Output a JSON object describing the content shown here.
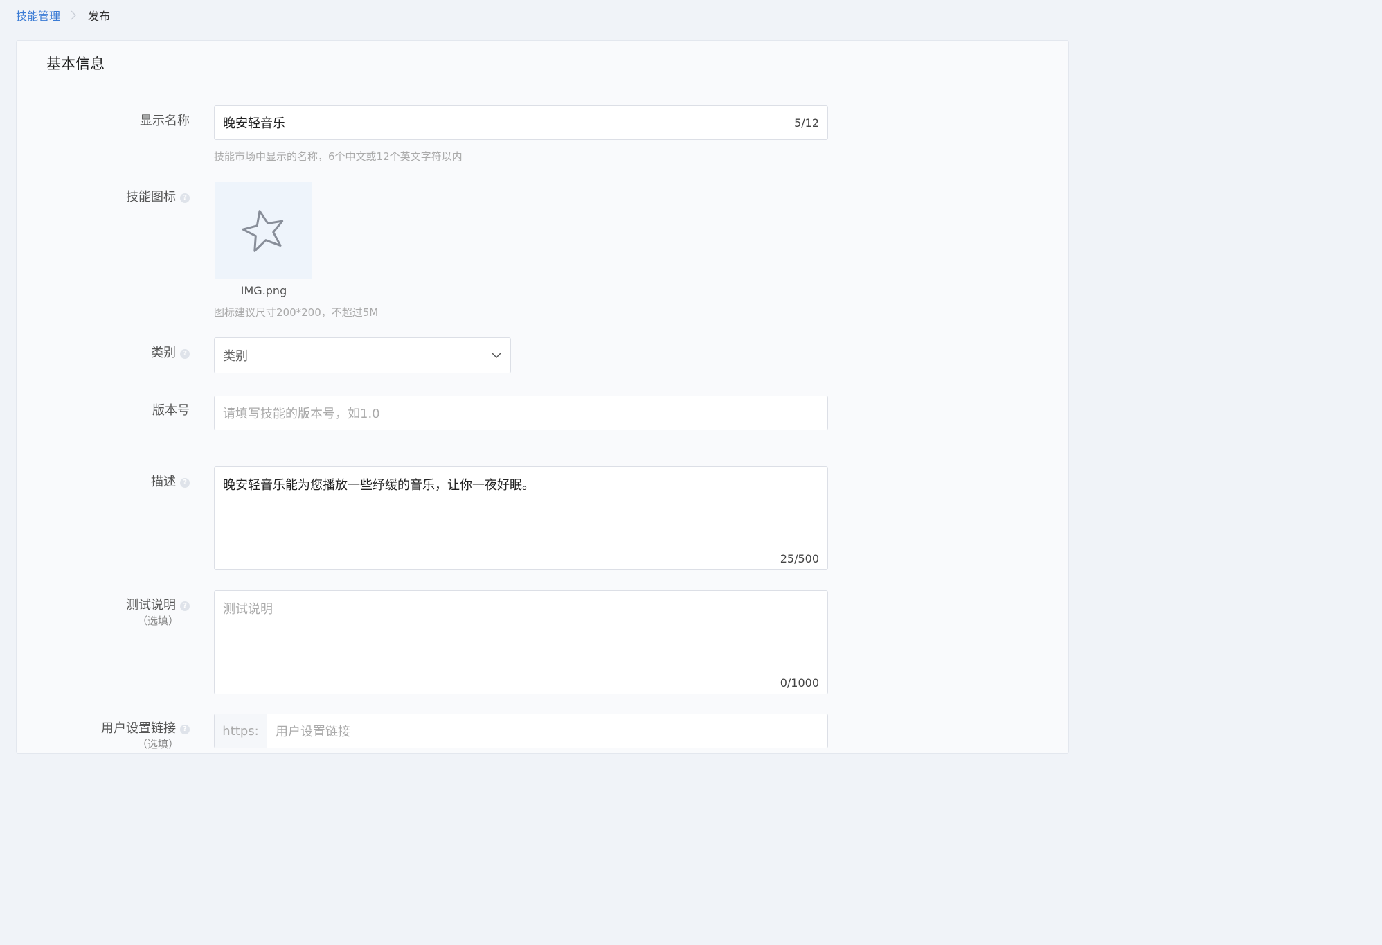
{
  "breadcrumb": {
    "parent": "技能管理",
    "current": "发布"
  },
  "section": {
    "title": "基本信息"
  },
  "form": {
    "display_name": {
      "label": "显示名称",
      "value": "晚安轻音乐",
      "counter": "5/12",
      "hint": "技能市场中显示的名称，6个中文或12个英文字符以内"
    },
    "skill_icon": {
      "label": "技能图标",
      "file_name": "IMG.png",
      "hint": "图标建议尺寸200*200，不超过5M"
    },
    "category": {
      "label": "类别",
      "value": "类别"
    },
    "version": {
      "label": "版本号",
      "placeholder": "请填写技能的版本号，如1.0"
    },
    "description": {
      "label": "描述",
      "value": "晚安轻音乐能为您播放一些纾缓的音乐，让你一夜好眠。",
      "counter": "25/500"
    },
    "test_notes": {
      "label": "测试说明",
      "sub_label": "（选填）",
      "placeholder": "测试说明",
      "counter": "0/1000"
    },
    "user_settings_link": {
      "label": "用户设置链接",
      "sub_label": "（选填）",
      "prefix": "https:",
      "placeholder": "用户设置链接"
    }
  },
  "icons": {
    "help": "question-mark-icon",
    "skill_placeholder": "star-icon",
    "select_arrow": "chevron-down-icon",
    "breadcrumb_sep": "chevron-right-icon"
  },
  "colors": {
    "link": "#3a7bd5",
    "background": "#f0f3f8",
    "card": "#f9fafc"
  }
}
